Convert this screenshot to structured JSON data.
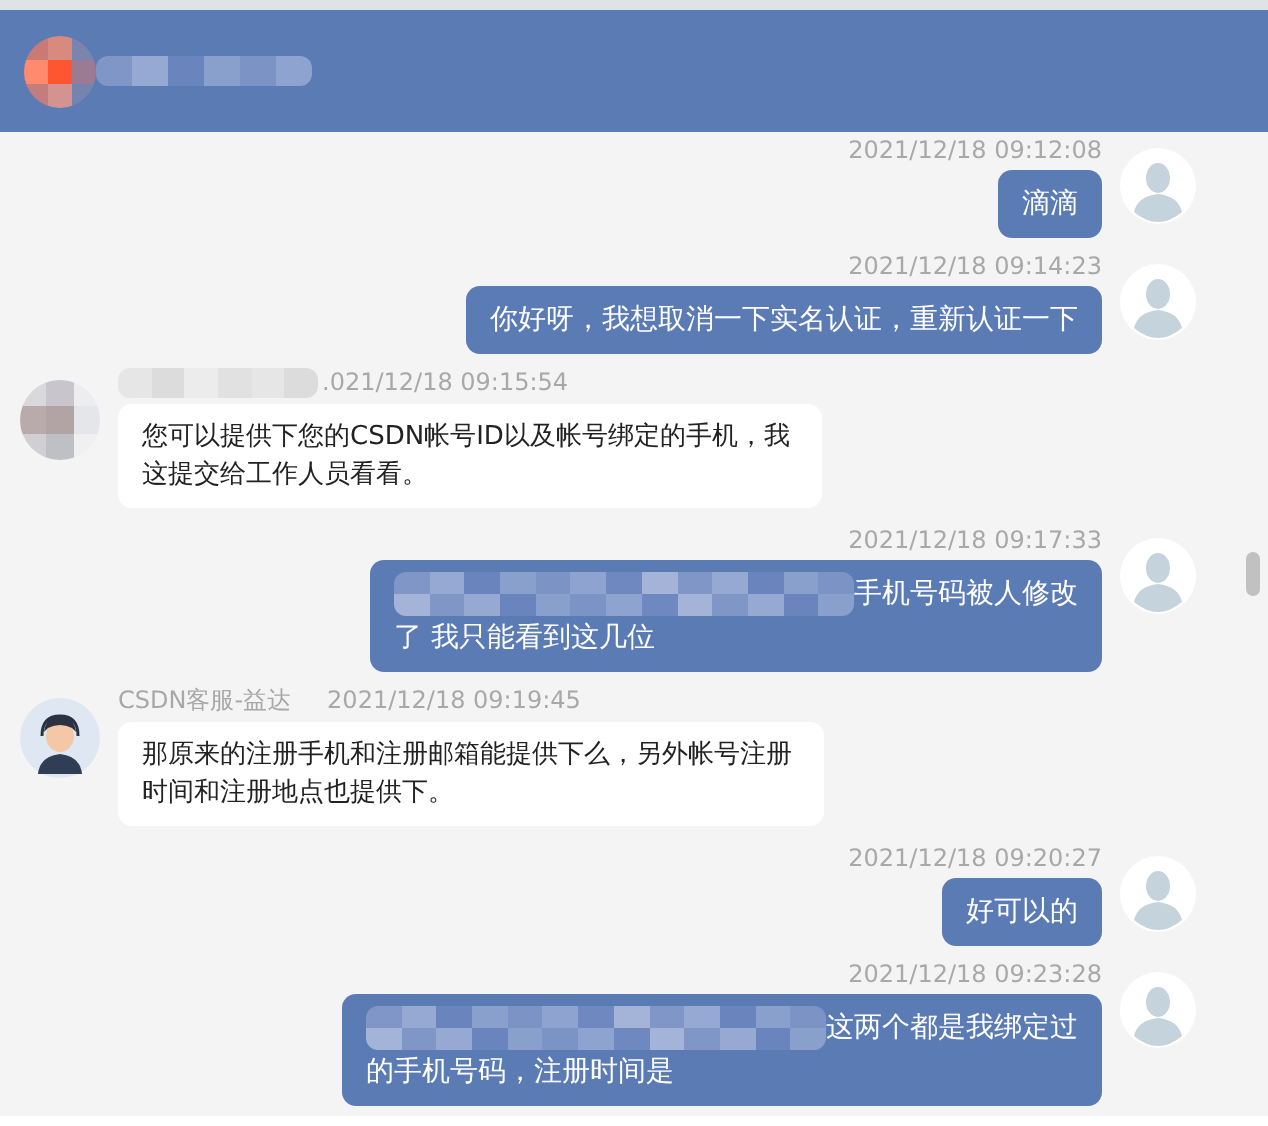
{
  "header": {
    "title_masked": true
  },
  "messages": [
    {
      "kind": "sent",
      "time": "2021/12/18 09:12:08",
      "lines": [
        {
          "text": "滴滴",
          "masked": false
        }
      ]
    },
    {
      "kind": "sent",
      "time": "2021/12/18 09:14:23",
      "lines": [
        {
          "text": "你好呀，我想取消一下实名认证，重新认证一下",
          "masked": false
        }
      ]
    },
    {
      "kind": "received",
      "name_masked": true,
      "time": ".021/12/18 09:15:54",
      "lines": [
        {
          "text": "您可以提供下您的CSDN帐号ID以及帐号绑定的手机，我",
          "masked": false
        },
        {
          "text": "这提交给工作人员看看。",
          "masked": false
        }
      ]
    },
    {
      "kind": "sent",
      "time": "2021/12/18 09:17:33",
      "lines": [
        {
          "text": "手机号码被人修改",
          "masked": true
        },
        {
          "text": "了 我只能看到这几位",
          "masked": false
        }
      ]
    },
    {
      "kind": "received",
      "name_masked": false,
      "name": "CSDN客服-益达",
      "time": "2021/12/18 09:19:45",
      "lines": [
        {
          "text": "那原来的注册手机和注册邮箱能提供下么，另外帐号注册",
          "masked": false
        },
        {
          "text": "时间和注册地点也提供下。",
          "masked": false
        }
      ]
    },
    {
      "kind": "sent",
      "time": "2021/12/18 09:20:27",
      "lines": [
        {
          "text": "好可以的",
          "masked": false
        }
      ]
    },
    {
      "kind": "sent",
      "time": "2021/12/18 09:23:28",
      "lines": [
        {
          "text": "这两个都是我绑定过",
          "masked": true
        },
        {
          "text": "的手机号码，注册时间是",
          "masked": false
        }
      ]
    }
  ]
}
